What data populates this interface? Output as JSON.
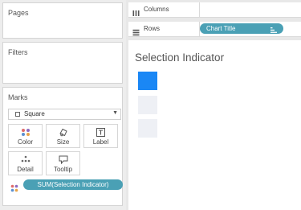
{
  "cards": {
    "pages_title": "Pages",
    "filters_title": "Filters",
    "marks_title": "Marks"
  },
  "marks": {
    "mark_type": "Square",
    "buttons": {
      "color": "Color",
      "size": "Size",
      "label": "Label",
      "detail": "Detail",
      "tooltip": "Tooltip"
    },
    "color_field": "SUM(Selection Indicator)"
  },
  "shelves": {
    "columns_label": "Columns",
    "rows_label": "Rows",
    "rows_pill": "Chart Title"
  },
  "view": {
    "title": "Selection Indicator",
    "marks": [
      {
        "color": "#1a87f5"
      },
      {
        "color": "#eef0f5"
      },
      {
        "color": "#eef0f5"
      }
    ]
  },
  "colors": {
    "pill": "#4aa0b5",
    "selected_mark": "#1a87f5",
    "unselected_mark": "#eef0f5"
  }
}
